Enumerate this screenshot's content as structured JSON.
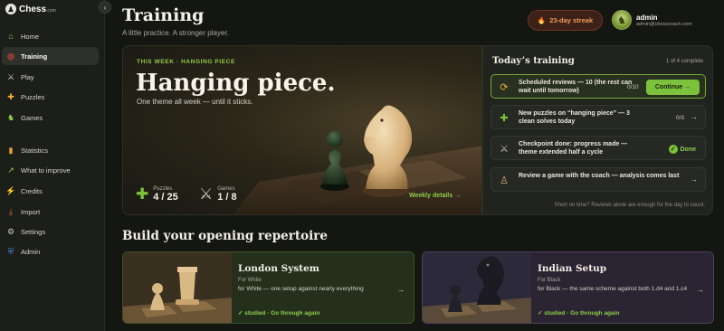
{
  "brand": {
    "name": "Chess",
    "suffix": ".com",
    "logo_icon": "pawn-logo-icon"
  },
  "sidebar": {
    "collapse_icon": "‹",
    "items": [
      {
        "label": "Home",
        "icon": "⌂",
        "icon_name": "home-icon",
        "color": "#8fce4a"
      },
      {
        "label": "Training",
        "icon": "◎",
        "icon_name": "target-icon",
        "color": "#e0453a",
        "active": true
      },
      {
        "label": "Play",
        "icon": "⚔",
        "icon_name": "swords-icon",
        "color": "#d8d6cf"
      },
      {
        "label": "Puzzles",
        "icon": "✚",
        "icon_name": "puzzle-icon",
        "color": "#f2b632"
      },
      {
        "label": "Games",
        "icon": "♞",
        "icon_name": "knight-icon",
        "color": "#8fce4a"
      },
      {
        "label": "Statistics",
        "icon": "▮",
        "icon_name": "bar-chart-icon",
        "color": "#e3a13a"
      },
      {
        "label": "What to improve",
        "icon": "↗",
        "icon_name": "trend-icon",
        "color": "#8fce4a"
      },
      {
        "label": "Credits",
        "icon": "⚡",
        "icon_name": "bolt-icon",
        "color": "#f2c632"
      },
      {
        "label": "Import",
        "icon": "⤓",
        "icon_name": "import-icon",
        "color": "#e0762f"
      },
      {
        "label": "Settings",
        "icon": "⚙",
        "icon_name": "gear-icon",
        "color": "#c9c6be"
      },
      {
        "label": "Admin",
        "icon": "⛨",
        "icon_name": "shield-icon",
        "color": "#4a8fe0"
      }
    ]
  },
  "header": {
    "title": "Training",
    "subtitle": "A little practice. A stronger player.",
    "streak": "23-day streak",
    "streak_icon": "🔥",
    "user_name": "admin",
    "user_email": "admin@chesscoach.com"
  },
  "hero": {
    "kicker": "THIS WEEK · HANGING PIECE",
    "title": "Hanging piece.",
    "subtitle": "One theme all week — until it sticks.",
    "puzzles_label": "Puzzles",
    "puzzles_value": "4 / 25",
    "games_label": "Games",
    "games_value": "1 / 8",
    "weekly_link": "Weekly details →"
  },
  "today": {
    "title": "Today’s training",
    "count": "1 of 4 complete",
    "tasks": [
      {
        "text": "Scheduled reviews — 10 (the rest can wait until tomorrow)",
        "progress": "0/10",
        "icon": "⟳",
        "icon_name": "refresh-icon"
      },
      {
        "text": "New puzzles on “hanging piece” — 3 clean solves today",
        "progress": "0/3",
        "icon": "✚",
        "icon_name": "puzzle-icon",
        "arrow": "→"
      },
      {
        "text": "Checkpoint done: progress made — theme extended half a cycle",
        "icon": "⚔",
        "icon_name": "swords-icon",
        "done_label": "Done"
      },
      {
        "text": "Review a game with the coach — analysis comes last",
        "icon": "♙",
        "icon_name": "coach-icon",
        "arrow": "→"
      }
    ],
    "continue_label": "Continue →",
    "note": "Short on time? Reviews alone are enough for the day to count."
  },
  "repertoire": {
    "title": "Build your opening repertoire",
    "cards": [
      {
        "name": "London System",
        "side": "For White",
        "desc": "for White — one setup against nearly everything",
        "status": "✓ studied · Go through again",
        "arrow": "→"
      },
      {
        "name": "Indian Setup",
        "side": "For Black",
        "desc": "for Black — the same scheme against both 1.d4 and 1.c4",
        "status": "✓ studied · Go through again",
        "arrow": "→"
      }
    ]
  },
  "colors": {
    "accent": "#7cc23c",
    "streak": "#f29a55",
    "background": "#141612"
  }
}
